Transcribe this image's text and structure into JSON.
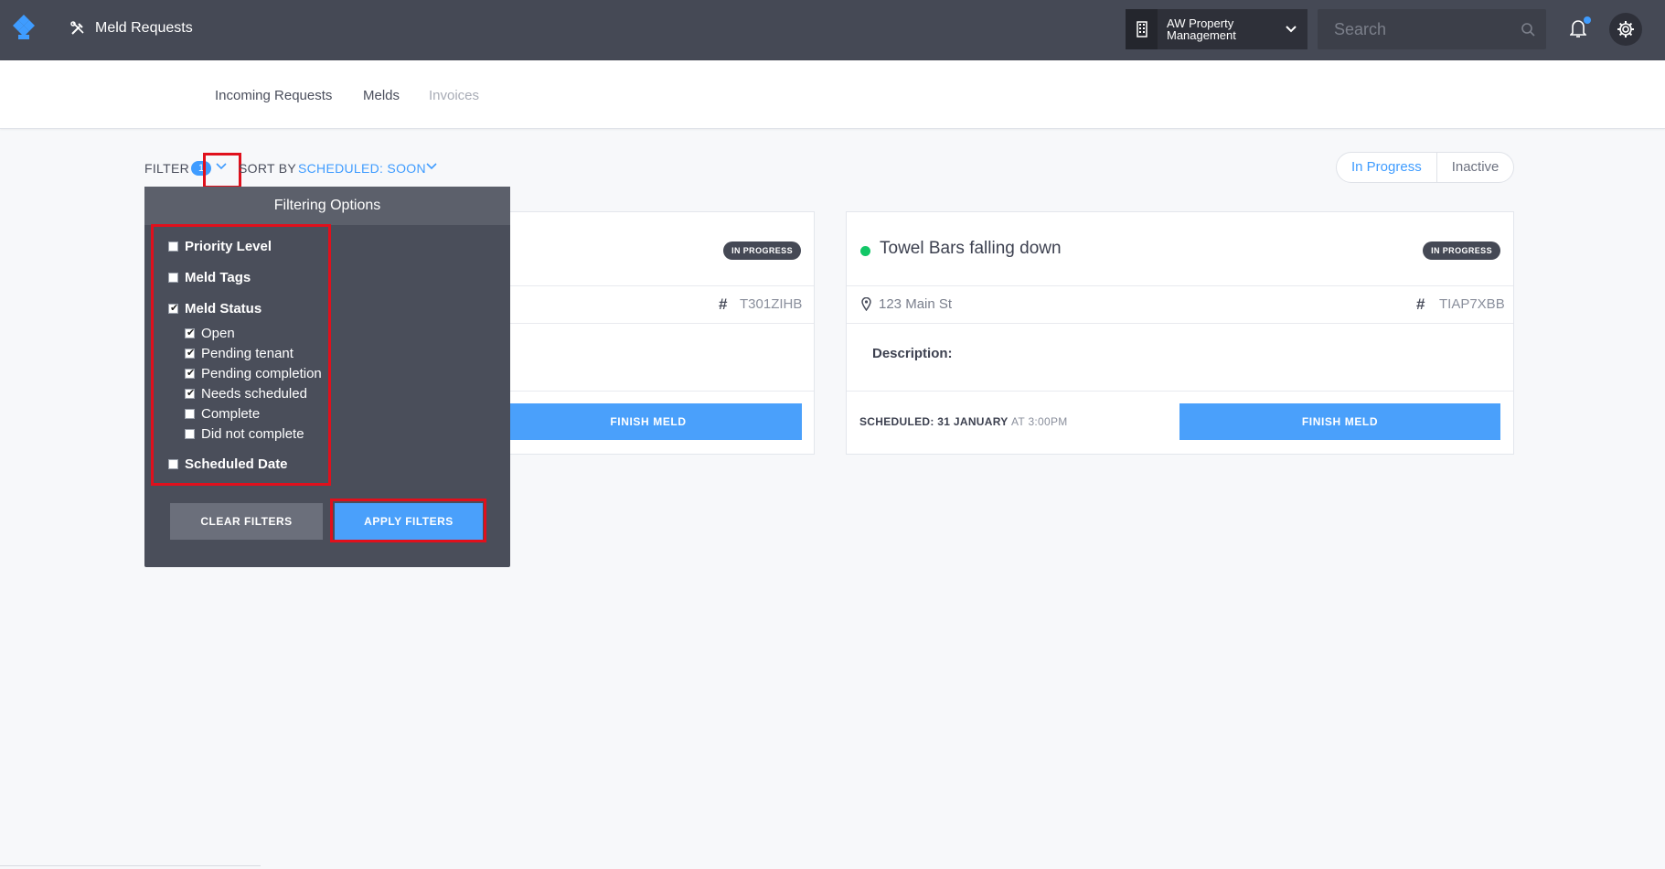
{
  "header": {
    "app_title": "Meld Requests",
    "org_name": "AW Property Management",
    "search_placeholder": "Search"
  },
  "subnav": {
    "items": [
      {
        "label": "Incoming Requests",
        "state": "normal"
      },
      {
        "label": "Melds",
        "state": "normal"
      },
      {
        "label": "Invoices",
        "state": "disabled"
      }
    ]
  },
  "toolbar": {
    "filter_label": "FILTER",
    "filter_count": "1",
    "sort_label": "SORT BY",
    "sort_value": "SCHEDULED: SOON",
    "toggles": [
      "In Progress",
      "Inactive"
    ]
  },
  "filter_popup": {
    "title": "Filtering Options",
    "options": [
      {
        "label": "Priority Level",
        "checked": false
      },
      {
        "label": "Meld Tags",
        "checked": false
      },
      {
        "label": "Meld Status",
        "checked": true
      },
      {
        "label": "Scheduled Date",
        "checked": false
      }
    ],
    "status_sub_options": [
      {
        "label": "Open",
        "checked": true
      },
      {
        "label": "Pending tenant",
        "checked": true
      },
      {
        "label": "Pending completion",
        "checked": true
      },
      {
        "label": "Needs scheduled",
        "checked": true
      },
      {
        "label": "Complete",
        "checked": false
      },
      {
        "label": "Did not complete",
        "checked": false
      }
    ],
    "clear_label": "CLEAR FILTERS",
    "apply_label": "APPLY FILTERS"
  },
  "cards": [
    {
      "status_badge": "IN PROGRESS",
      "ref_id": "T301ZIHB",
      "finish_label": "FINISH MELD"
    },
    {
      "title": "Towel Bars falling down",
      "status_badge": "IN PROGRESS",
      "address": "123 Main St",
      "ref_id": "TIAP7XBB",
      "description_label": "Description:",
      "scheduled_prefix": "SCHEDULED: 31 JANUARY",
      "scheduled_time": "AT 3:00PM",
      "finish_label": "FINISH MELD"
    }
  ],
  "colors": {
    "header_bg": "#454955",
    "accent": "#3f9cff",
    "status_green": "#12c767",
    "highlight": "#e0101c"
  }
}
